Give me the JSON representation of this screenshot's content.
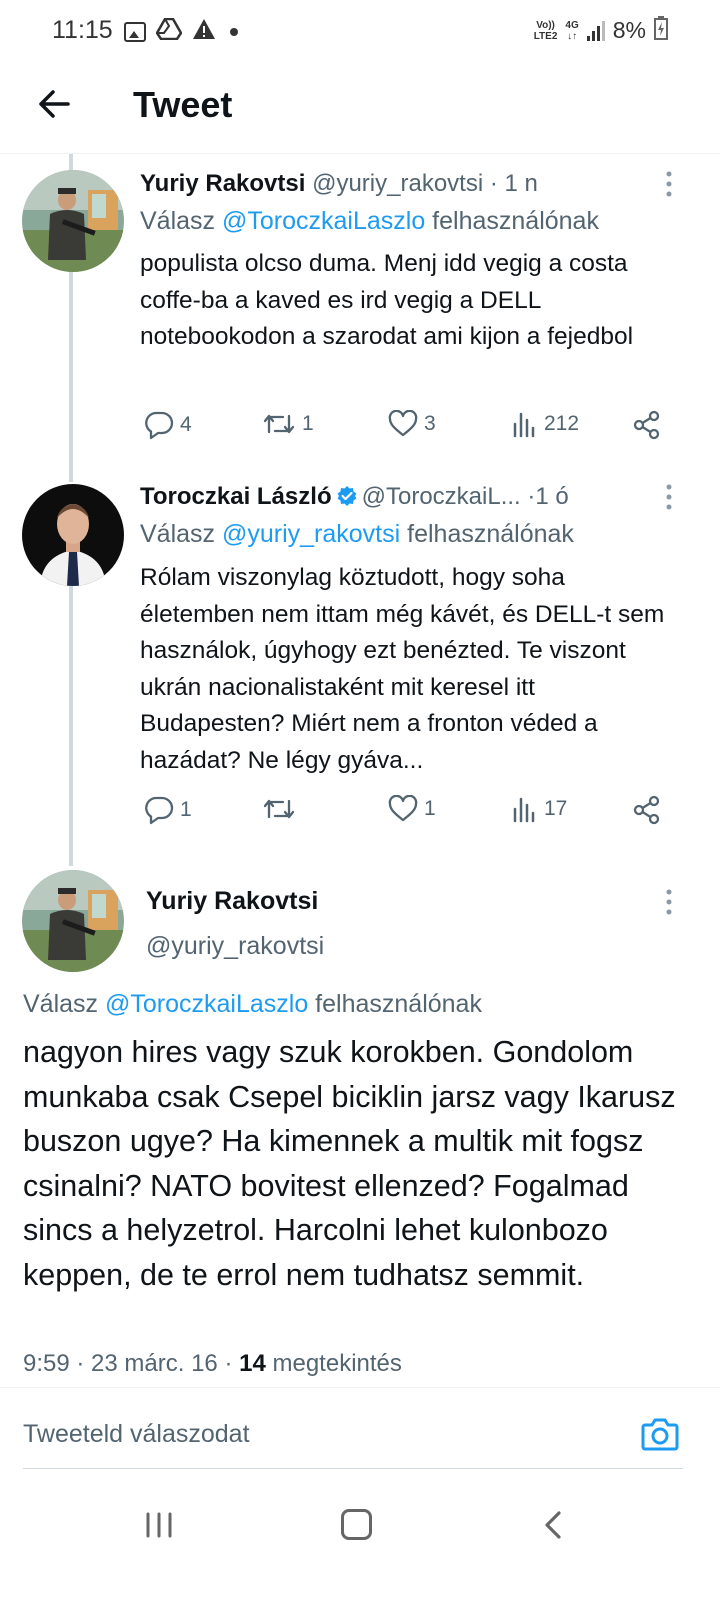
{
  "status_bar": {
    "time": "11:15",
    "network_top": "Vo))",
    "network_bottom": "LTE2",
    "data_top": "4G",
    "data_bottom": "↓↑",
    "battery": "8%"
  },
  "header": {
    "title": "Tweet"
  },
  "tweets": [
    {
      "name": "Yuriy Rakovtsi",
      "handle": "@yuriy_rakovtsi",
      "separator": "·",
      "age": "1 n",
      "reply_prefix": "Válasz ",
      "reply_mention": "@ToroczkaiLaszlo",
      "reply_suffix": " felhasználónak",
      "text": "populista olcso duma. Menj idd vegig a costa coffe-ba a kaved es ird vegig a DELL notebookodon a szarodat ami kijon a fejedbol",
      "replies": "4",
      "retweets": "1",
      "likes": "3",
      "views": "212"
    },
    {
      "name": "Toroczkai László",
      "handle": "@ToroczkaiL...",
      "separator": "·",
      "age": "1 ó",
      "reply_prefix": "Válasz ",
      "reply_mention": "@yuriy_rakovtsi",
      "reply_suffix": " felhasználónak",
      "text": "Rólam viszonylag köztudott, hogy soha életemben nem ittam még kávét, és DELL-t sem használok, úgyhogy ezt benézted. Te viszont ukrán nacionalistaként mit keresel itt Budapesten? Miért nem a fronton véded a hazádat? Ne légy gyáva...",
      "replies": "1",
      "retweets": "",
      "likes": "1",
      "views": "17"
    }
  ],
  "main_tweet": {
    "name": "Yuriy Rakovtsi",
    "handle": "@yuriy_rakovtsi",
    "reply_prefix": "Válasz ",
    "reply_mention": "@ToroczkaiLaszlo",
    "reply_suffix": " felhasználónak",
    "text": "nagyon hires vagy szuk korokben. Gondolom munkaba csak Csepel biciklin jarsz vagy Ikarusz buszon ugye? Ha kimennek a multik mit fogsz csinalni? NATO bovitest ellenzed? Fogalmad sincs a helyzetrol. Harcolni lehet kulonbozo keppen, de te errol nem tudhatsz semmit.",
    "time": "9:59",
    "date": "23 márc. 16",
    "views_count": "14",
    "views_label": "megtekintés",
    "meta_sep": " · "
  },
  "reply_box": {
    "placeholder": "Tweeteld válaszodat"
  },
  "colors": {
    "accent": "#1d9bf0",
    "text": "#0f1419",
    "secondary": "#536471",
    "thread_line": "#cfd9de"
  },
  "icons": {
    "back": "arrow-left-icon",
    "more": "more-vertical-icon",
    "reply": "reply-bubble-icon",
    "retweet": "retweet-icon",
    "like": "heart-icon",
    "views": "bar-chart-icon",
    "share": "share-icon",
    "camera": "camera-icon",
    "verified": "verified-badge-icon"
  }
}
